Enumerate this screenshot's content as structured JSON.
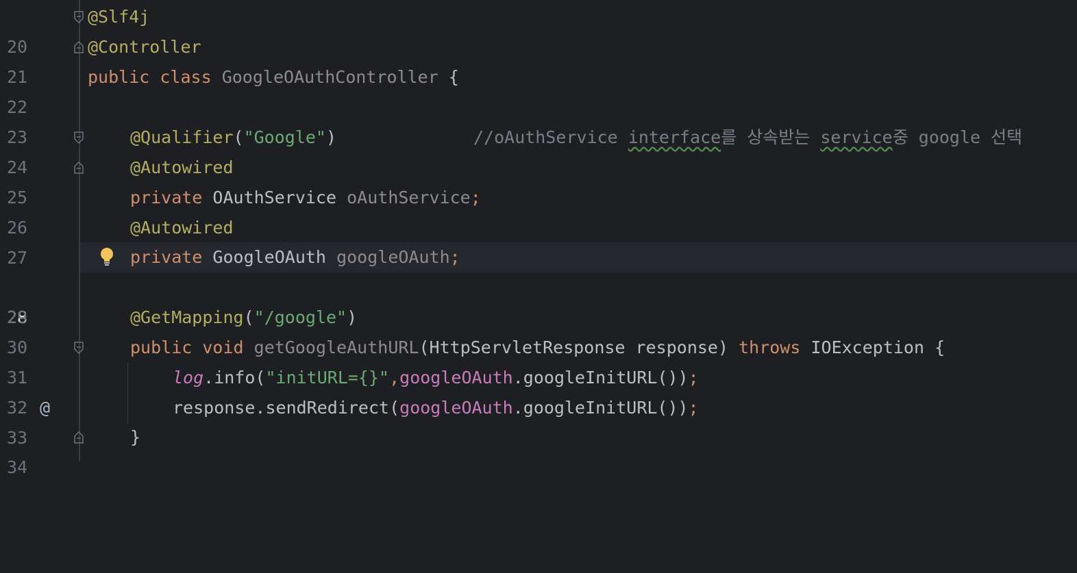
{
  "editor": {
    "current_line": "28",
    "lines": [
      {
        "no": "20",
        "ann": "@Slf4j"
      },
      {
        "no": "21",
        "ann": "@Controller"
      },
      {
        "no": "22",
        "kw1": "public",
        "kw2": "class",
        "cls": "GoogleOAuthController",
        "brace": "{"
      },
      {
        "no": "23"
      },
      {
        "no": "24",
        "ann": "@Qualifier",
        "open": "(",
        "str": "\"Google\"",
        "close": ")",
        "comment_pre": "//oAuthService ",
        "comment_w1": "interface",
        "comment_mid": "를 상속받는 ",
        "comment_w2": "service",
        "comment_post": "중 google 선택"
      },
      {
        "no": "25",
        "ann": "@Autowired"
      },
      {
        "no": "26",
        "kw": "private",
        "type": "OAuthService",
        "name": "oAuthService",
        "semi": ";"
      },
      {
        "no": "27",
        "ann": "@Autowired"
      },
      {
        "no": "28",
        "kw": "private",
        "type": "GoogleOAuth",
        "name": "googleOAuth",
        "semi": ";"
      },
      {
        "no": "29"
      },
      {
        "no": "30",
        "ann": "@GetMapping",
        "open": "(",
        "str": "\"/google\"",
        "close": ")"
      },
      {
        "no": "31",
        "kw1": "public",
        "kw2": "void",
        "method": "getGoogleAuthURL",
        "params": "(HttpServletResponse response)",
        "kw3": "throws",
        "exc": "IOException",
        "brace": "{"
      },
      {
        "no": "32",
        "log": "log",
        "call": ".info(",
        "str": "\"initURL={}\"",
        "comma": ",",
        "fld": "googleOAuth",
        "rest": ".googleInitURL())",
        "semi": ";"
      },
      {
        "no": "33",
        "pre": "response.sendRedirect(",
        "fld": "googleOAuth",
        "rest": ".googleInitURL())",
        "semi": ";"
      },
      {
        "no": "34",
        "brace": "}"
      }
    ],
    "gutter_icons": {
      "override_marker": "@"
    }
  },
  "colors": {
    "background": "#1e1f22",
    "current_line": "#26282e",
    "keyword": "#cf8e6d",
    "annotation": "#b3ae60",
    "string": "#6aab73",
    "field": "#c77dbb",
    "comment": "#7a7e85"
  }
}
